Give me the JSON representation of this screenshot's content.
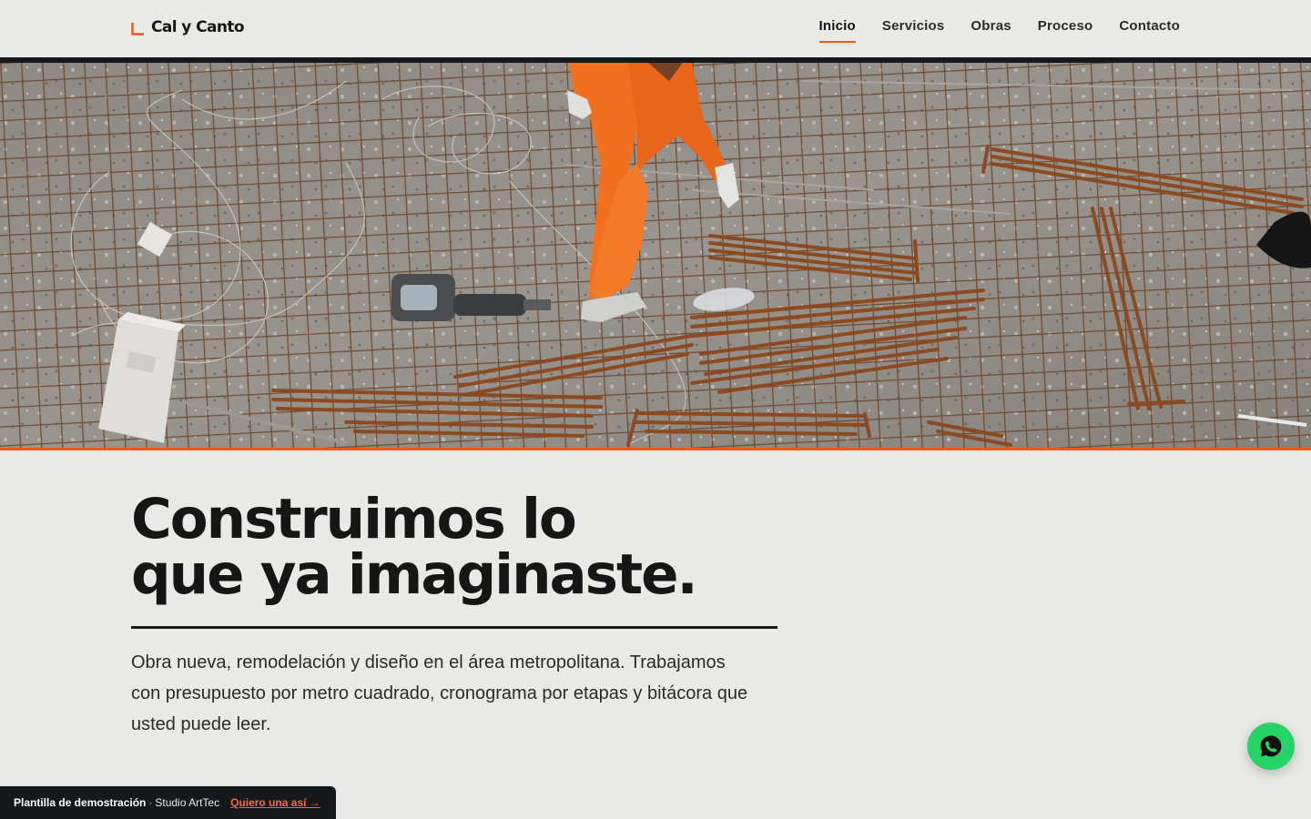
{
  "brand": {
    "name": "Cal y Canto",
    "logo_icon": "corner-bracket-icon",
    "accent_color": "#ea5a1c"
  },
  "nav": {
    "items": [
      {
        "label": "Inicio",
        "active": true
      },
      {
        "label": "Servicios",
        "active": false
      },
      {
        "label": "Obras",
        "active": false
      },
      {
        "label": "Proceso",
        "active": false
      },
      {
        "label": "Contacto",
        "active": false
      }
    ]
  },
  "hero": {
    "image": "construction-worker-on-rebar-mesh-photo",
    "headline_line1": "Construimos lo",
    "headline_line2": "que ya imaginaste.",
    "lead": "Obra nueva, remodelación y diseño en el área metropolitana. Trabajamos con presupuesto por metro cuadrado, cronograma por etapas y bitácora que usted puede leer."
  },
  "whatsapp": {
    "icon": "whatsapp-icon",
    "color": "#25d366"
  },
  "demo_bar": {
    "label": "Plantilla de demostración",
    "separator": "·",
    "studio": "Studio ArtTec",
    "cta": "Quiero una así →"
  }
}
